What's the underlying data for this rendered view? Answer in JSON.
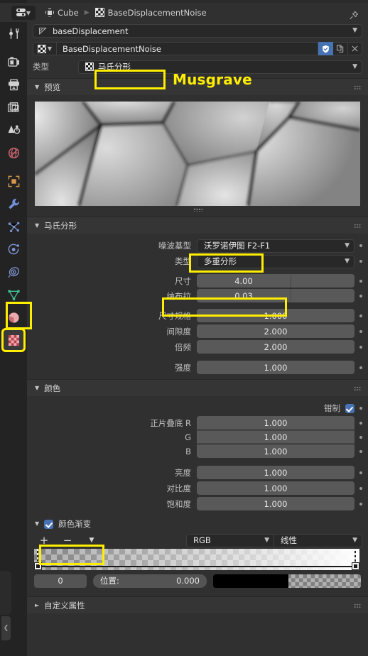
{
  "header": {
    "editor_type_icon": "properties-editor-icon",
    "breadcrumb": [
      {
        "icon": "object-icon",
        "label": "Cube"
      },
      {
        "icon": "texture-checker-icon",
        "label": "BaseDisplacementNoise"
      }
    ],
    "pin_icon": "pin-icon"
  },
  "sidebar": {
    "items": [
      {
        "name": "tool",
        "icon": "tool-icon"
      },
      {
        "name": "render",
        "icon": "render-camera-icon"
      },
      {
        "name": "output",
        "icon": "printer-output-icon"
      },
      {
        "name": "view-layer",
        "icon": "images-stack-icon"
      },
      {
        "name": "scene",
        "icon": "scene-cone-icon"
      },
      {
        "name": "world",
        "icon": "world-globe-icon"
      },
      {
        "name": "object",
        "icon": "object-square-icon"
      },
      {
        "name": "modifiers",
        "icon": "wrench-icon"
      },
      {
        "name": "particles",
        "icon": "particles-icon"
      },
      {
        "name": "physics",
        "icon": "physics-orbit-icon"
      },
      {
        "name": "constraints",
        "icon": "constraint-icon"
      },
      {
        "name": "object-data",
        "icon": "mesh-data-triangle-icon"
      },
      {
        "name": "material",
        "icon": "material-sphere-icon"
      },
      {
        "name": "texture",
        "icon": "texture-checker-icon",
        "selected": true
      }
    ]
  },
  "slots": {
    "modifier_slot": {
      "label": "baseDisplacement",
      "icon": "displace-modifier-icon"
    },
    "texture_block": {
      "name": "BaseDisplacementNoise",
      "icon": "texture-checker-icon",
      "shield_icon": "fake-user-shield-icon",
      "copy_icon": "new-copy-icon",
      "close_icon": "unlink-x-icon"
    }
  },
  "type_row": {
    "label": "类型",
    "value": "马氏分形",
    "icon": "texture-checker-icon",
    "annotation": "Musgrave"
  },
  "preview": {
    "title": "预览"
  },
  "musgrave": {
    "title": "马氏分形",
    "rows": [
      {
        "label": "噪波基型",
        "value": "沃罗诺伊图 F2-F1",
        "kind": "dropdown",
        "highlight": true
      },
      {
        "label": "类型",
        "value": "多重分形",
        "kind": "dropdown",
        "highlight": false
      },
      {
        "label": "尺寸",
        "value": "4.00",
        "kind": "slider-half",
        "highlight": true
      },
      {
        "label": "纳布拉",
        "value": "0.03",
        "kind": "slider-half",
        "highlight": false
      },
      {
        "label": "尺寸规格",
        "value": "1.000",
        "kind": "slider",
        "highlight": false
      },
      {
        "label": "间隙度",
        "value": "2.000",
        "kind": "slider",
        "highlight": false
      },
      {
        "label": "倍频",
        "value": "2.000",
        "kind": "slider",
        "highlight": false
      },
      {
        "label": "强度",
        "value": "1.000",
        "kind": "slider",
        "highlight": false
      }
    ]
  },
  "colors_panel": {
    "title": "颜色",
    "clamp": {
      "label": "钳制",
      "checked": true
    },
    "rows": [
      {
        "label": "正片叠底 R",
        "value": "1.000"
      },
      {
        "label": "G",
        "value": "1.000"
      },
      {
        "label": "B",
        "value": "1.000"
      },
      {
        "label": "亮度",
        "value": "1.000"
      },
      {
        "label": "对比度",
        "value": "1.000"
      },
      {
        "label": "饱和度",
        "value": "1.000"
      }
    ]
  },
  "color_ramp": {
    "title": "颜色渐变",
    "enabled": true,
    "toolbar": {
      "add_label": "+",
      "remove_label": "−",
      "menu_icon": "chevron-down-icon",
      "interpolation_mode": "RGB",
      "interpolation_curve": "线性"
    },
    "active_index": "0",
    "position_label": "位置:",
    "position_value": "0.000",
    "stops": [
      {
        "position": 0.0,
        "color": "#000000",
        "alpha": 0.0
      },
      {
        "position": 1.0,
        "color": "#ffffff",
        "alpha": 1.0
      }
    ],
    "swatch_color": "#000000"
  },
  "custom_props": {
    "title": "自定义属性"
  },
  "theme": {
    "accent_highlight": "#ffee00",
    "checkbox_blue": "#4772b3",
    "panel_bg": "#303030",
    "field_bg": "#545454"
  }
}
